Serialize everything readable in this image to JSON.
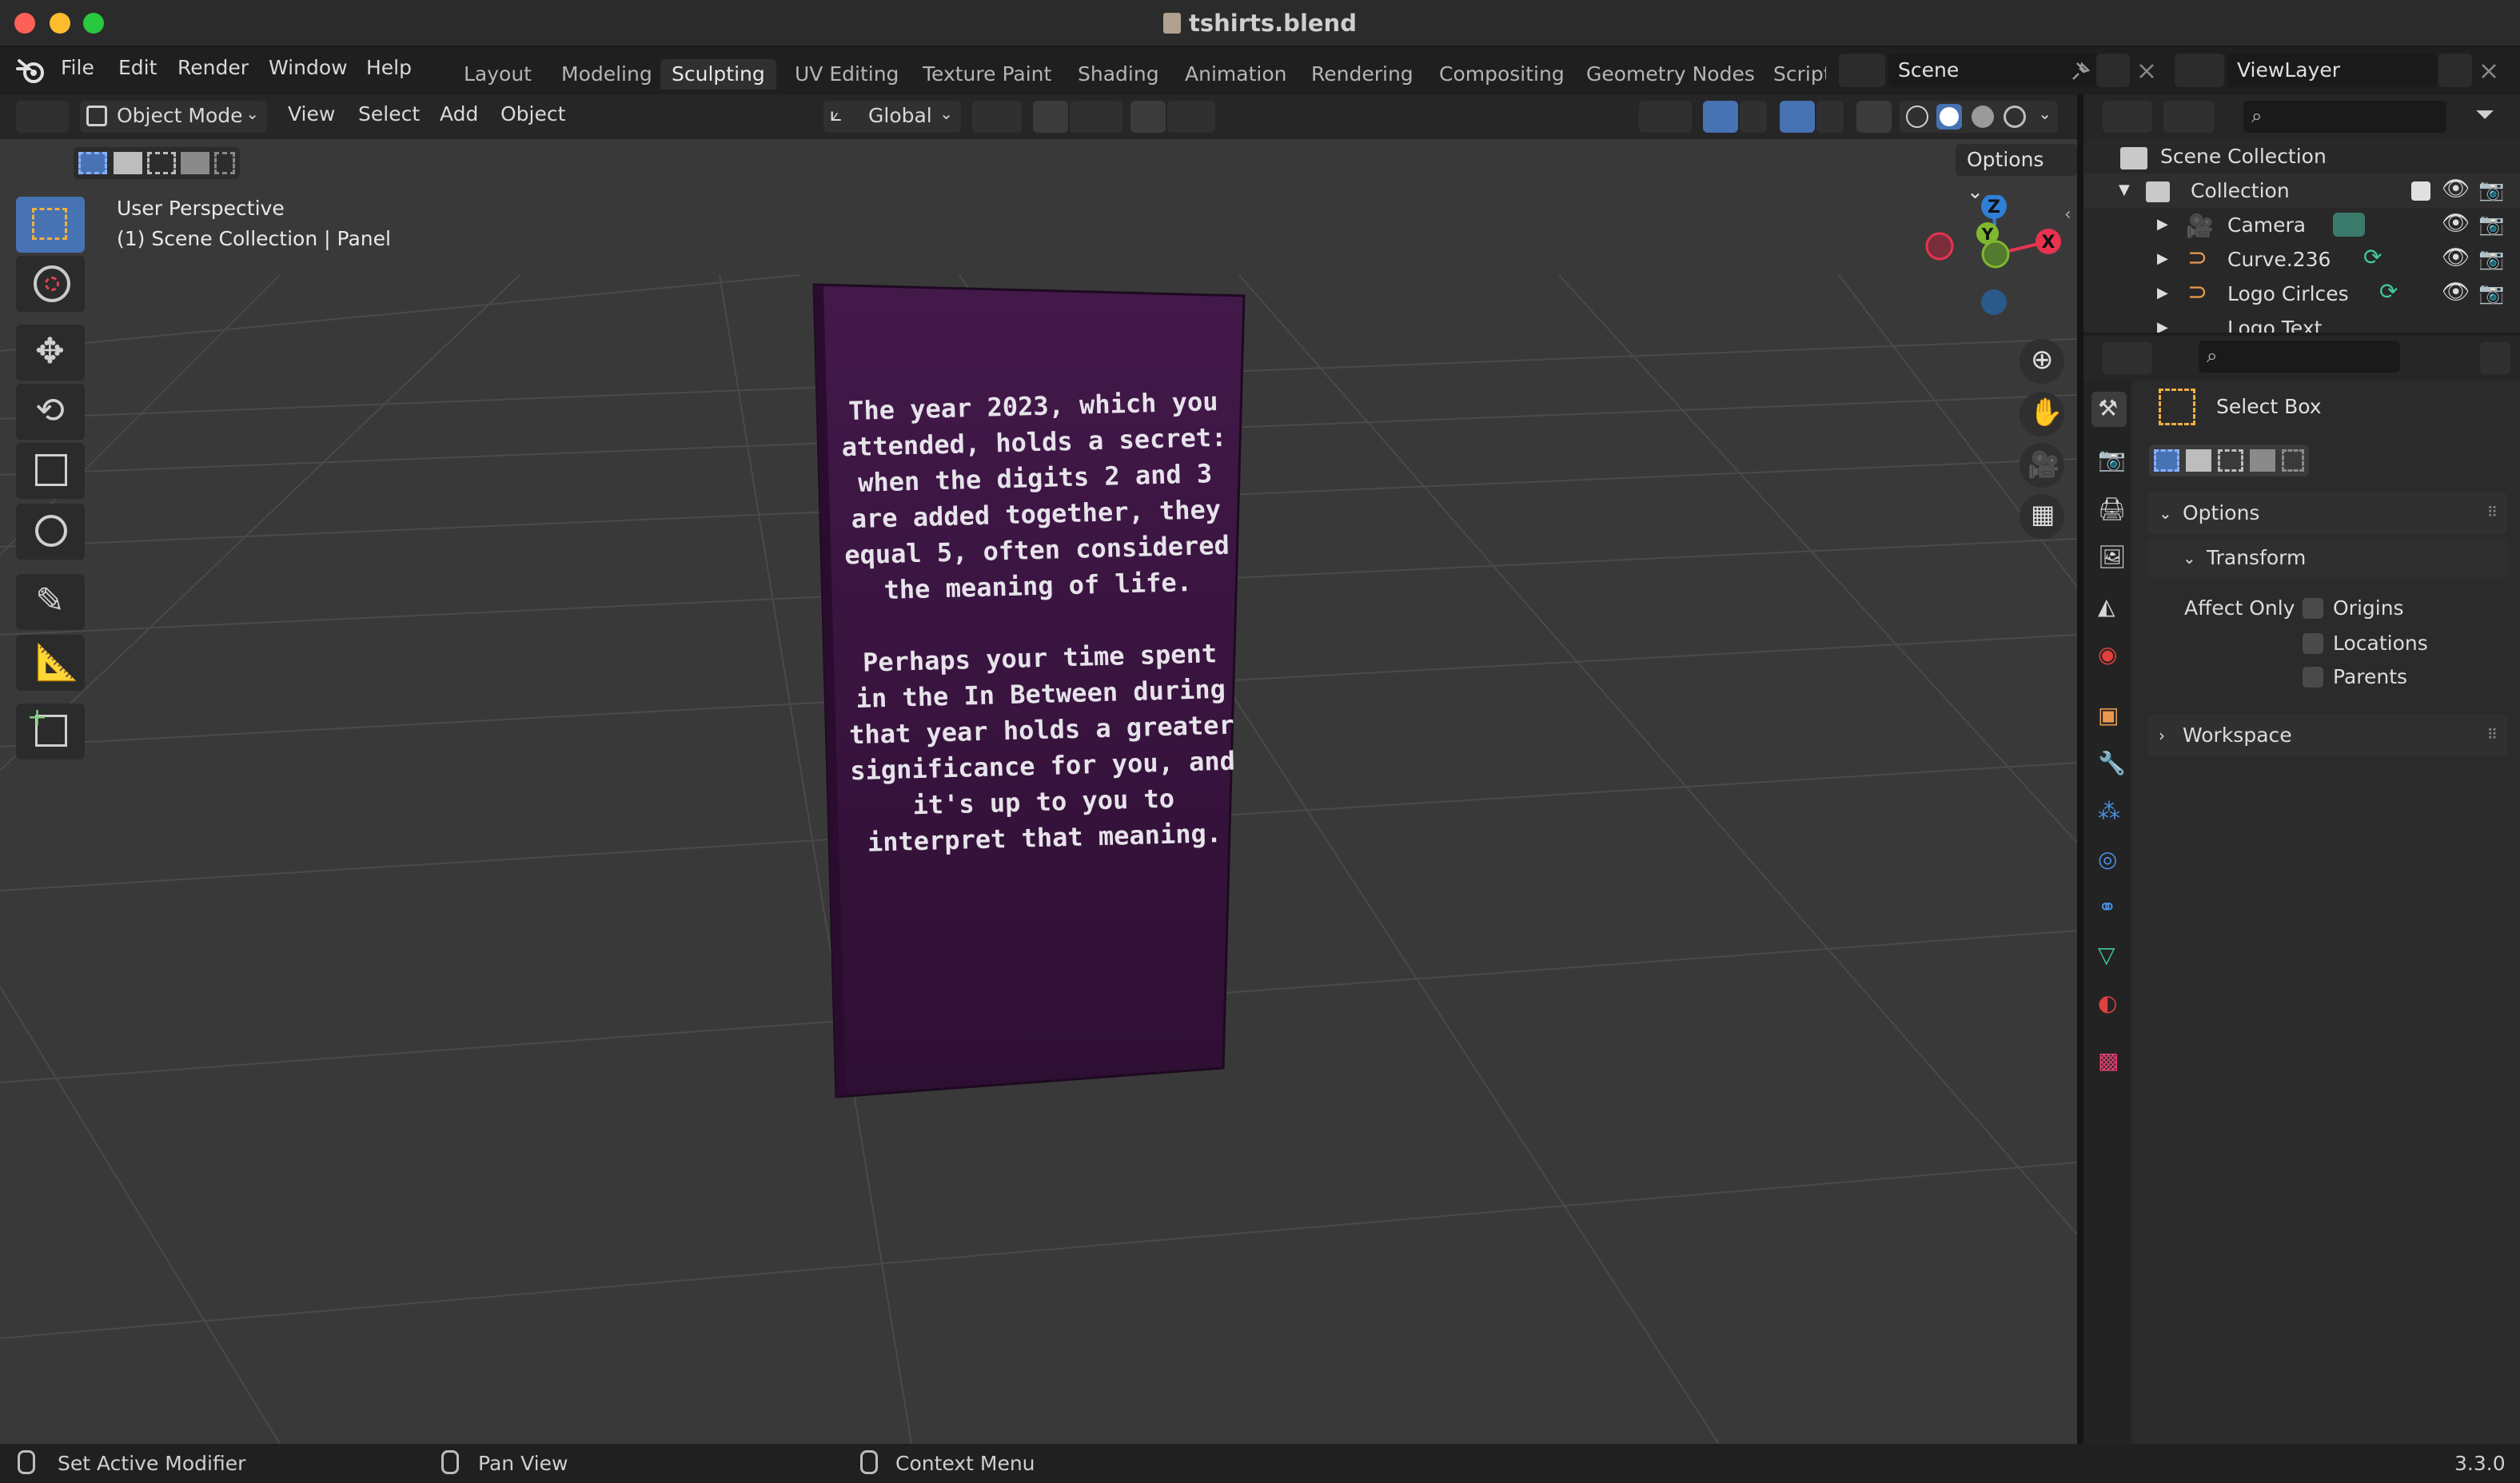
{
  "window": {
    "title": "tshirts.blend"
  },
  "menus": [
    "File",
    "Edit",
    "Render",
    "Window",
    "Help"
  ],
  "workspaces": [
    "Layout",
    "Modeling",
    "Sculpting",
    "UV Editing",
    "Texture Paint",
    "Shading",
    "Animation",
    "Rendering",
    "Compositing",
    "Geometry Nodes",
    "Script"
  ],
  "active_workspace": "Sculpting",
  "scene": {
    "label": "Scene"
  },
  "view_layer": {
    "label": "ViewLayer"
  },
  "viewport_header": {
    "mode": "Object Mode",
    "menus": [
      "View",
      "Select",
      "Add",
      "Object"
    ],
    "orientation": "Global",
    "options_label": "Options"
  },
  "viewport": {
    "perspective": "User Perspective",
    "context": "(1) Scene Collection | Panel",
    "gizmo": {
      "z": "Z",
      "y": "Y",
      "x": "X"
    },
    "card_paragraph1": "The year 2023, which you attended, holds a secret: when the digits 2 and 3 are added together, they equal 5, often considered the meaning of life.",
    "card_paragraph2": "Perhaps your time spent in the In Between during that year holds a greater significance for you, and it's up to you to interpret that meaning.",
    "card_color": "#3d1740"
  },
  "outliner": {
    "root": "Scene Collection",
    "collection": "Collection",
    "items": [
      "Camera",
      "Curve.236",
      "Logo Cirlces",
      "Logo Text"
    ]
  },
  "properties": {
    "tool_name": "Select Box",
    "options_label": "Options",
    "transform_label": "Transform",
    "affect_only_label": "Affect Only",
    "checks": [
      "Origins",
      "Locations",
      "Parents"
    ],
    "workspace_label": "Workspace"
  },
  "statusbar": {
    "left": "Set Active Modifier",
    "middle": "Pan View",
    "right": "Context Menu",
    "version": "3.3.0"
  },
  "colors": {
    "accent": "#4772b3",
    "x_axis": "#e8334f",
    "y_axis": "#7fb82f",
    "z_axis": "#2f7fd7"
  }
}
